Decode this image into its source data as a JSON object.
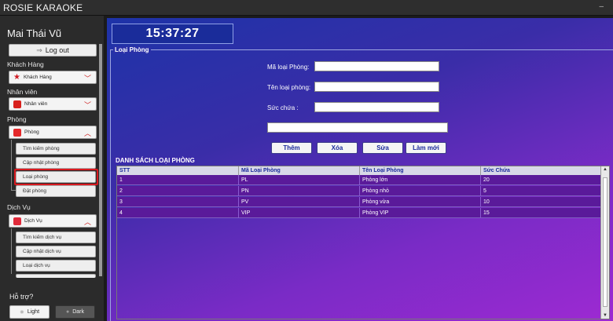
{
  "app": {
    "title": "ROSIE KARAOKE",
    "minimize": "–"
  },
  "sidebar": {
    "user_name": "Mai Thái Vũ",
    "logout_label": "Log out",
    "sections": {
      "khach_hang": {
        "label": "Khách Hàng",
        "dropdown": "Khách Hàng"
      },
      "nhan_vien": {
        "label": "Nhân viên",
        "dropdown": "Nhân viên"
      },
      "phong": {
        "label": "Phòng",
        "dropdown": "Phòng",
        "items": [
          "Tìm kiếm phòng",
          "Cập nhật phòng",
          "Loại phòng",
          "Đặt phòng"
        ]
      },
      "dich_vu": {
        "label": "Dịch Vụ",
        "dropdown": "Dịch Vụ",
        "items": [
          "Tìm kiếm dịch vụ",
          "Cập nhật dịch vụ",
          "Loại dịch vụ"
        ]
      }
    },
    "help_label": "Hỗ trợ?",
    "light_label": "Light",
    "dark_label": "Dark",
    "selected_item": "Loại phòng"
  },
  "main": {
    "clock": "15:37:27",
    "section_title": "Loại Phòng",
    "form": {
      "ma_loai_label": "Mã loại Phòng:",
      "ma_loai_value": "",
      "ten_loai_label": "Tên loại phòng:",
      "ten_loai_value": "",
      "suc_chua_label": "Sức chứa :",
      "suc_chua_value": "",
      "extra_value": ""
    },
    "buttons": {
      "them": "Thêm",
      "xoa": "Xóa",
      "sua": "Sửa",
      "lam_moi": "Làm mới"
    },
    "list_title": "DANH SÁCH LOẠI PHÒNG",
    "table": {
      "headers": [
        "STT",
        "Mã Loại Phòng",
        "Tên Loại Phòng",
        "Sức Chứa"
      ],
      "rows": [
        [
          "1",
          "PL",
          "Phòng lớn",
          "20"
        ],
        [
          "2",
          "PN",
          "Phòng nhỏ",
          "5"
        ],
        [
          "3",
          "PV",
          "Phòng vừa",
          "10"
        ],
        [
          "4",
          "VIP",
          "Phòng VIP",
          "15"
        ]
      ]
    }
  },
  "colors": {
    "accent_red": "#d8181e",
    "main_gradient_start": "#1d33a8",
    "main_gradient_end": "#9d2ad2",
    "row_bg": "#5a1a9a"
  }
}
